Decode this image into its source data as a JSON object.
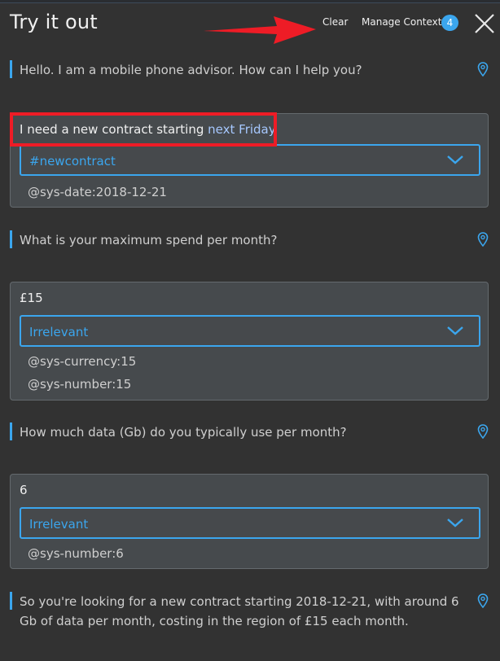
{
  "header": {
    "title": "Try it out",
    "clear_label": "Clear",
    "manage_context_label": "Manage Context",
    "context_count": "4"
  },
  "conversation": [
    {
      "role": "bot",
      "text": "Hello. I am a mobile phone advisor. How can I help you?"
    },
    {
      "role": "user",
      "text_before": "I need a new contract starting ",
      "text_entity": "next Friday",
      "intent": "#newcontract",
      "entities": [
        "@sys-date:2018-12-21"
      ]
    },
    {
      "role": "bot",
      "text": "What is your maximum spend per month?"
    },
    {
      "role": "user",
      "text": "£15",
      "intent": "Irrelevant",
      "entities": [
        "@sys-currency:15",
        "@sys-number:15"
      ]
    },
    {
      "role": "bot",
      "text": "How much data (Gb) do you typically use per month?"
    },
    {
      "role": "user",
      "text": "6",
      "intent": "Irrelevant",
      "entities": [
        "@sys-number:6"
      ]
    },
    {
      "role": "bot",
      "text": "So you're looking for a new contract starting 2018-12-21, with around 6 Gb of data per month, costing in the region of £15 each month."
    }
  ],
  "colors": {
    "accent": "#3ba6ee",
    "annotation": "#ee1c26",
    "background": "#323232",
    "panel": "#464a4d"
  },
  "icons": {
    "close": "close-icon",
    "location": "location-pin-icon",
    "chevron": "chevron-down-icon"
  }
}
